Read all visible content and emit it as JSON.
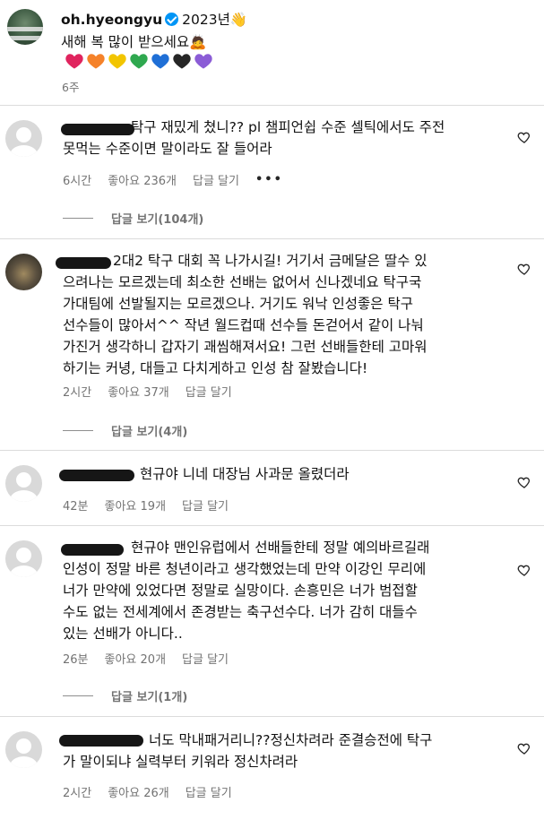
{
  "caption": {
    "username": "oh.hyeongyu",
    "year_text": "2023년👋",
    "line2": "새해 복 많이 받으세요🙇",
    "hearts": [
      "#e0245e",
      "#f5822a",
      "#f2c500",
      "#2fa84f",
      "#1f6fd6",
      "#262626",
      "#8b5cd6"
    ],
    "time": "6주"
  },
  "comments": [
    {
      "text": "탁구 재밌게 쳤니?? pl 챔피언쉽 수준 셀틱에서도 주전\n못먹는 수준이면 말이라도 잘 들어라",
      "time": "6시간",
      "likes": "좋아요 236개",
      "reply": "답글 달기",
      "more": "•••",
      "view_replies": "답글 보기(104개)"
    },
    {
      "text": "2대2 탁구 대회 꼭 나가시길! 거기서 금메달은 딸수 있\n으려나는 모르겠는데 최소한 선배는 없어서 신나겠네요 탁구국\n가대팀에 선발될지는 모르겠으나. 거기도 워낙 인성좋은 탁구\n선수들이 많아서^^ 작년 월드컵때 선수들 돈걷어서 같이 나눠\n가진거 생각하니 갑자기 괘씸해져서요! 그런 선배들한테 고마워\n하기는 커녕, 대들고 다치게하고 인성 참 잘봤습니다!",
      "time": "2시간",
      "likes": "좋아요 37개",
      "reply": "답글 달기",
      "view_replies": "답글 보기(4개)"
    },
    {
      "text": "현규야 니네 대장님 사과문 올렸더라",
      "time": "42분",
      "likes": "좋아요 19개",
      "reply": "답글 달기"
    },
    {
      "text": "현규야 맨인유럽에서 선배들한테 정말 예의바르길래\n인성이 정말 바른 청년이라고 생각했었는데 만약 이강인 무리에\n너가 만약에 있었다면 정말로 실망이다. 손흥민은 너가 범접할\n수도 없는 전세계에서 존경받는 축구선수다. 너가 감히 대들수\n있는 선배가 아니다..",
      "time": "26분",
      "likes": "좋아요 20개",
      "reply": "답글 달기",
      "view_replies": "답글 보기(1개)"
    },
    {
      "text": "너도 막내패거리니??정신차려라 준결승전에 탁구\n가 말이되냐 실력부터 키워라 정신차려라",
      "time": "2시간",
      "likes": "좋아요 26개",
      "reply": "답글 달기"
    }
  ]
}
